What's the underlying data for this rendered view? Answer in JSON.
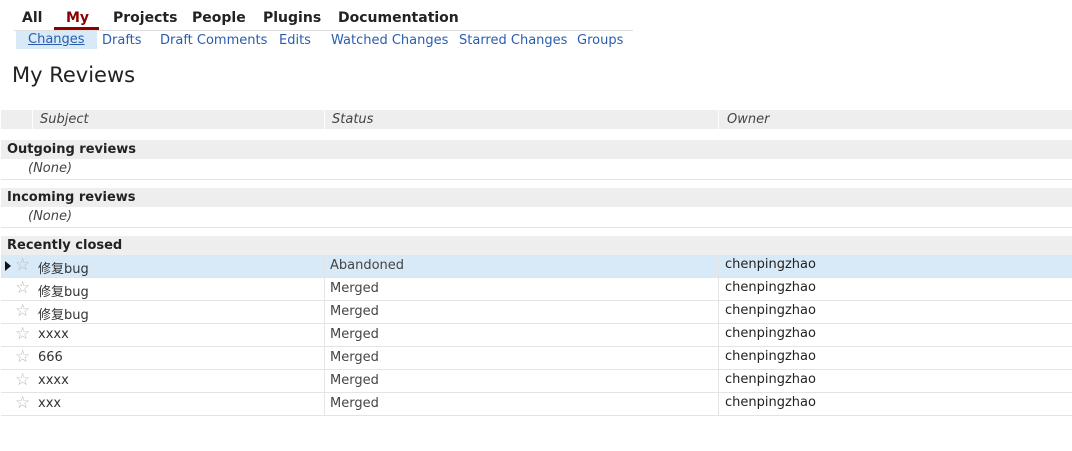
{
  "top_menu": {
    "items": [
      {
        "label": "All"
      },
      {
        "label": "My"
      },
      {
        "label": "Projects"
      },
      {
        "label": "People"
      },
      {
        "label": "Plugins"
      },
      {
        "label": "Documentation"
      }
    ],
    "active": "My"
  },
  "sub_menu": {
    "items": [
      {
        "label": "Changes"
      },
      {
        "label": "Drafts"
      },
      {
        "label": "Draft Comments"
      },
      {
        "label": "Edits"
      },
      {
        "label": "Watched Changes"
      },
      {
        "label": "Starred Changes"
      },
      {
        "label": "Groups"
      }
    ],
    "active": "Changes"
  },
  "page_title": "My Reviews",
  "table": {
    "columns": {
      "subject": "Subject",
      "status": "Status",
      "owner": "Owner"
    },
    "sections": {
      "outgoing": {
        "title": "Outgoing reviews",
        "empty": "(None)"
      },
      "incoming": {
        "title": "Incoming reviews",
        "empty": "(None)"
      },
      "closed": {
        "title": "Recently closed"
      }
    },
    "closed_rows": [
      {
        "subject": "修复bug",
        "status": "Abandoned",
        "owner": "chenpingzhao",
        "starred": false,
        "selected": true
      },
      {
        "subject": "修复bug",
        "status": "Merged",
        "owner": "chenpingzhao",
        "starred": false,
        "selected": false
      },
      {
        "subject": "修复bug",
        "status": "Merged",
        "owner": "chenpingzhao",
        "starred": false,
        "selected": false
      },
      {
        "subject": "xxxx",
        "status": "Merged",
        "owner": "chenpingzhao",
        "starred": false,
        "selected": false
      },
      {
        "subject": "666",
        "status": "Merged",
        "owner": "chenpingzhao",
        "starred": false,
        "selected": false
      },
      {
        "subject": "xxxx",
        "status": "Merged",
        "owner": "chenpingzhao",
        "starred": false,
        "selected": false
      },
      {
        "subject": "xxx",
        "status": "Merged",
        "owner": "chenpingzhao",
        "starred": false,
        "selected": false
      }
    ],
    "star_glyph": "☆"
  },
  "colors": {
    "active_menu": "#8b0000",
    "link": "#2a5db0",
    "selected_row": "#d8eaf8",
    "section_bg": "#eeeeee"
  }
}
